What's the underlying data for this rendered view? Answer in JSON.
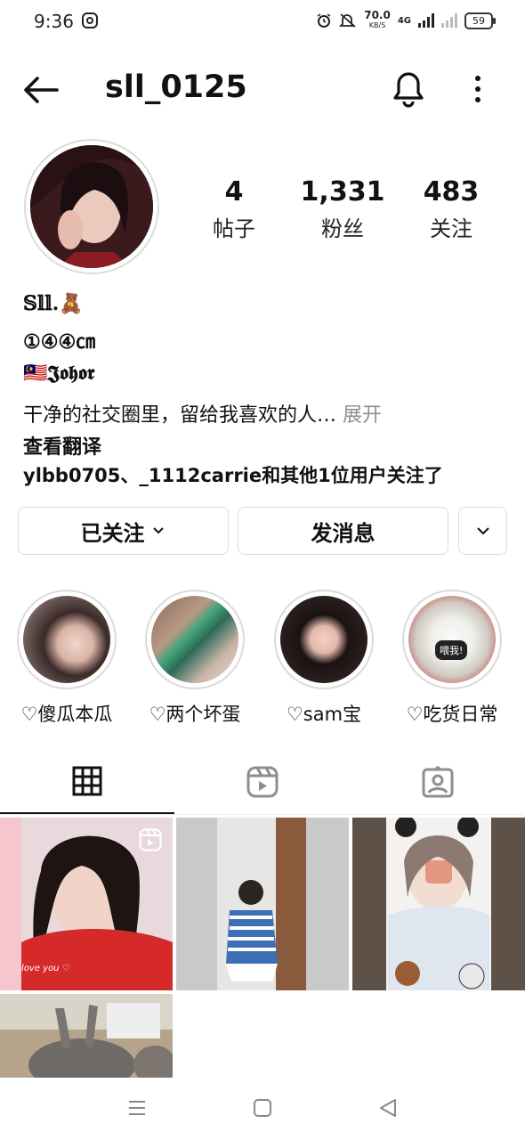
{
  "status_bar": {
    "time": "9:36",
    "net_speed": "70.0",
    "net_unit": "KB/S",
    "network": "4G",
    "battery": "59"
  },
  "header": {
    "username": "sll_0125"
  },
  "stats": [
    {
      "value": "4",
      "label": "帖子"
    },
    {
      "value": "1,331",
      "label": "粉丝"
    },
    {
      "value": "483",
      "label": "关注"
    }
  ],
  "bio": {
    "name": "𝕊𝕝𝕝.🧸",
    "height": "①④④㎝",
    "location": "🇲🇾𝕵𝖔𝖍𝖔𝖗",
    "text": "干净的社交圈里，留给我喜欢的人…",
    "more": "展开",
    "translate": "查看翻译",
    "followed_by": "ylbb0705、_1112carrie和其他1位用户关注了"
  },
  "actions": {
    "following": "已关注",
    "message": "发消息"
  },
  "highlights": [
    {
      "label": "♡傻瓜本瓜"
    },
    {
      "label": "♡两个坏蛋"
    },
    {
      "label": "♡sam宝"
    },
    {
      "label": "♡吃货日常"
    }
  ],
  "highlight_sticker": "喂我!",
  "posts": [
    {
      "caption": "love you ♡"
    }
  ],
  "icons": {
    "back": "arrow-left-icon",
    "bell": "bell-icon",
    "more": "more-vertical-icon",
    "grid": "grid-icon",
    "reels": "reels-icon",
    "tagged": "tagged-icon"
  }
}
